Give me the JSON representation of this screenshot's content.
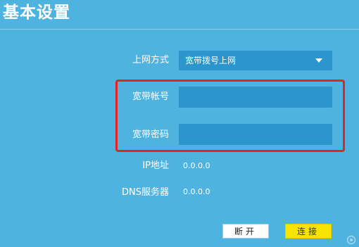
{
  "page": {
    "title": "基本设置"
  },
  "form": {
    "connection_type": {
      "label": "上网方式",
      "selected": "宽带拨号上网"
    },
    "account": {
      "label": "宽带帐号",
      "value": ""
    },
    "password": {
      "label": "宽带密码",
      "value": ""
    },
    "ip_address": {
      "label": "IP地址",
      "value": "0.0.0.0"
    },
    "dns_server": {
      "label": "DNS服务器",
      "value": "0.0.0.0"
    }
  },
  "actions": {
    "disconnect_label": "断开",
    "connect_label": "连接"
  },
  "colors": {
    "background": "#4fb3df",
    "field": "#2c95cc",
    "highlight": "#e32424",
    "connect_button": "#f6e400"
  },
  "icons": {
    "select_arrow": "caret-down-icon",
    "corner_badge": "watermark-icon"
  }
}
